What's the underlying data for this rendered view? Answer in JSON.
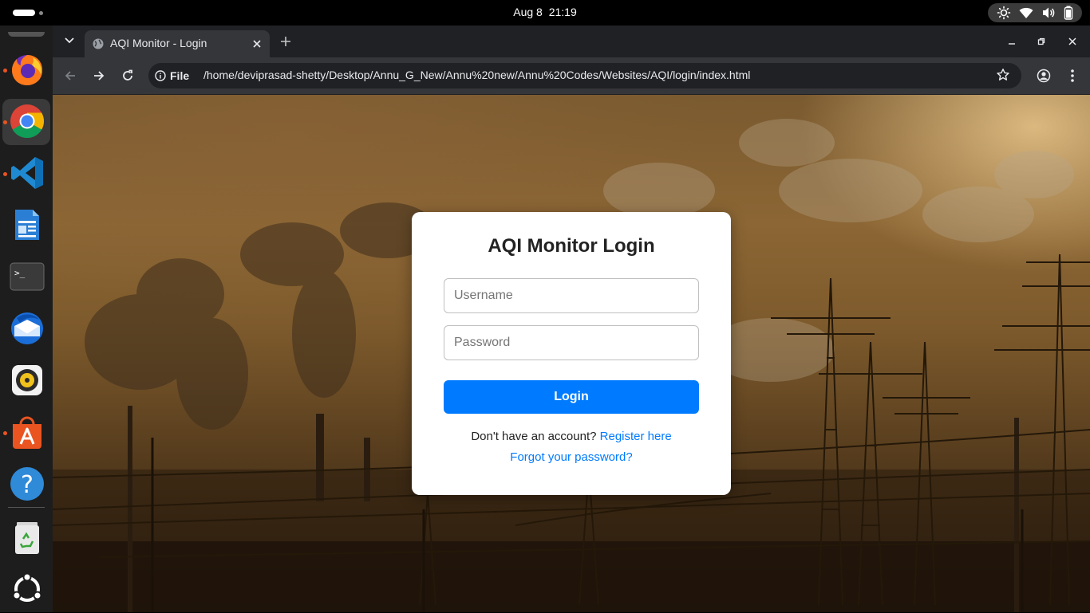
{
  "topbar": {
    "date": "Aug 8",
    "time": "21:19"
  },
  "dock": {
    "items": [
      {
        "name": "firefox",
        "running": true
      },
      {
        "name": "chrome",
        "running": true,
        "active": true
      },
      {
        "name": "vscode",
        "running": true
      },
      {
        "name": "libreoffice-writer",
        "running": false
      },
      {
        "name": "terminal",
        "running": false
      },
      {
        "name": "thunderbird",
        "running": false
      },
      {
        "name": "rhythmbox",
        "running": false
      },
      {
        "name": "app-center",
        "running": true
      },
      {
        "name": "help",
        "running": false
      },
      {
        "name": "trash",
        "running": false
      },
      {
        "name": "show-apps",
        "running": false
      }
    ],
    "terminal_prompt": ">_"
  },
  "browser": {
    "tab_title": "AQI Monitor - Login",
    "url_chip": "File",
    "url": "/home/deviprasad-shetty/Desktop/Annu_G_New/Annu%20new/Annu%20Codes/Websites/AQI/login/index.html"
  },
  "login": {
    "title": "AQI Monitor Login",
    "username_placeholder": "Username",
    "password_placeholder": "Password",
    "button_label": "Login",
    "register_prompt": "Don't have an account?",
    "register_link": "Register here",
    "forgot_link": "Forgot your password?"
  },
  "colors": {
    "accent": "#007bff",
    "ubuntu_orange": "#e95420"
  }
}
